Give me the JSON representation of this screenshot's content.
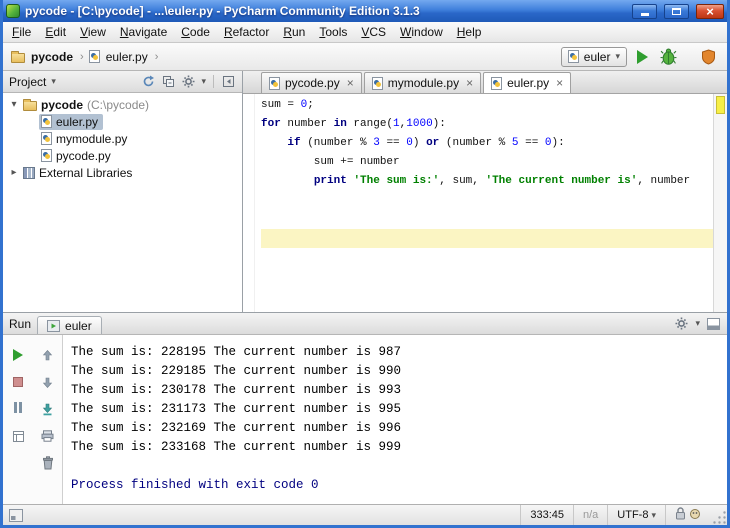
{
  "window": {
    "title": "pycode - [C:\\pycode] - ...\\euler.py - PyCharm Community Edition 3.1.3"
  },
  "menu": {
    "items": [
      "File",
      "Edit",
      "View",
      "Navigate",
      "Code",
      "Refactor",
      "Run",
      "Tools",
      "VCS",
      "Window",
      "Help"
    ]
  },
  "toolbar": {
    "breadcrumb": [
      "pycode",
      "euler.py"
    ],
    "run_config": "euler"
  },
  "project_panel": {
    "title": "Project",
    "root_label": "pycode",
    "root_path": "(C:\\pycode)",
    "files": [
      "euler.py",
      "mymodule.py",
      "pycode.py"
    ],
    "selected_file": "euler.py",
    "external_libraries": "External Libraries"
  },
  "editor": {
    "tabs": [
      "pycode.py",
      "mymodule.py",
      "euler.py"
    ],
    "active_tab": "euler.py",
    "close_glyph": "×",
    "caret_line": 8,
    "code": [
      [
        [
          "sum = ",
          ""
        ],
        [
          "0",
          "num"
        ],
        [
          ";",
          ""
        ]
      ],
      [
        [
          "for",
          "kw"
        ],
        [
          " number ",
          ""
        ],
        [
          "in",
          "kw"
        ],
        [
          " range(",
          ""
        ],
        [
          "1",
          "num"
        ],
        [
          ",",
          ""
        ],
        [
          "1000",
          "num"
        ],
        [
          "):",
          ""
        ]
      ],
      [
        [
          "    ",
          ""
        ],
        [
          "if",
          "kw"
        ],
        [
          " (number % ",
          ""
        ],
        [
          "3",
          "num"
        ],
        [
          " == ",
          ""
        ],
        [
          "0",
          "num"
        ],
        [
          ") ",
          ""
        ],
        [
          "or",
          "kw"
        ],
        [
          " (number % ",
          ""
        ],
        [
          "5",
          "num"
        ],
        [
          " == ",
          ""
        ],
        [
          "0",
          "num"
        ],
        [
          "):",
          ""
        ]
      ],
      [
        [
          "        sum += number",
          ""
        ]
      ],
      [
        [
          "        ",
          ""
        ],
        [
          "print",
          "kw"
        ],
        [
          " ",
          ""
        ],
        [
          "'The sum is:'",
          "str"
        ],
        [
          ", sum, ",
          ""
        ],
        [
          "'The current number is'",
          "str"
        ],
        [
          ", number",
          ""
        ]
      ]
    ]
  },
  "run_panel": {
    "title": "Run",
    "tab": "euler",
    "console": [
      {
        "text": "The sum is: 228195 The current number is 987",
        "stream": "stdout"
      },
      {
        "text": "The sum is: 229185 The current number is 990",
        "stream": "stdout"
      },
      {
        "text": "The sum is: 230178 The current number is 993",
        "stream": "stdout"
      },
      {
        "text": "The sum is: 231173 The current number is 995",
        "stream": "stdout"
      },
      {
        "text": "The sum is: 232169 The current number is 996",
        "stream": "stdout"
      },
      {
        "text": "The sum is: 233168 The current number is 999",
        "stream": "stdout"
      },
      {
        "text": "",
        "stream": "stdout"
      },
      {
        "text": "Process finished with exit code 0",
        "stream": "system"
      }
    ]
  },
  "status_bar": {
    "caret_position": "333:45",
    "vcs_branch": "n/a",
    "encoding": "UTF-8"
  },
  "colors": {
    "keyword": "#000080",
    "string": "#008000",
    "number": "#0000ff",
    "caret_line": "#fbf5c3",
    "selection": "#b2c1d2",
    "titlebar_top": "#74a9ef",
    "titlebar_bottom": "#1f5ab8",
    "run_green": "#2f9e2f",
    "warning_stripe": "#f7ef48"
  }
}
